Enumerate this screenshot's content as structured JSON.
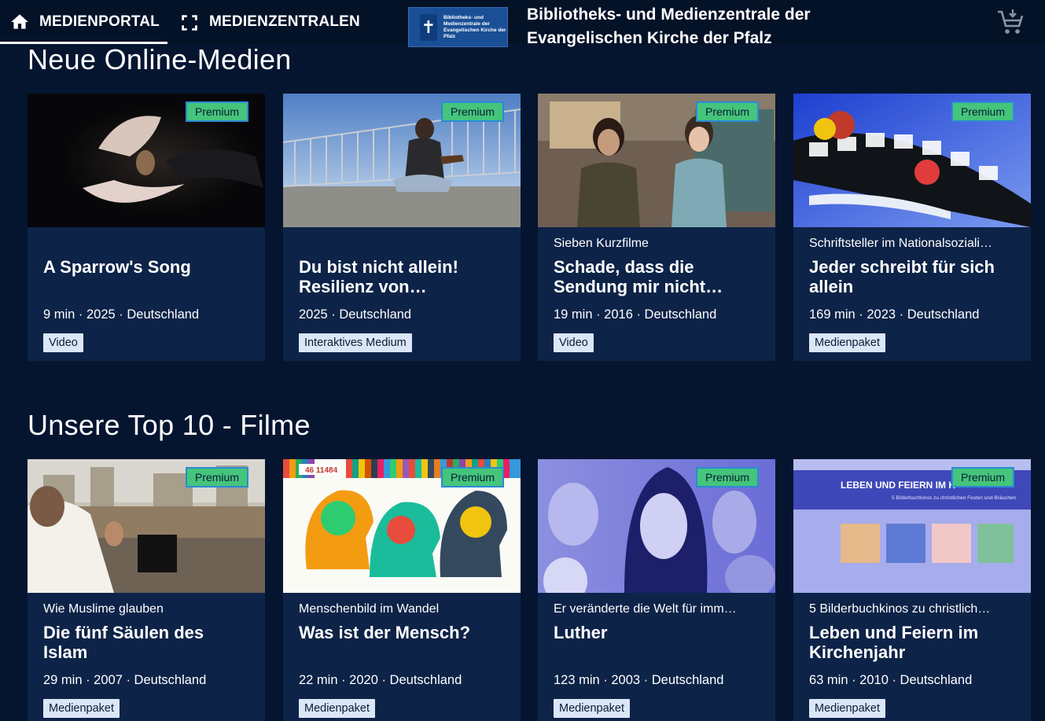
{
  "nav": {
    "portal_label": "MEDIENPORTAL",
    "zentralen_label": "MEDIENZENTRALEN"
  },
  "org": {
    "logo_text": "Bibliotheks- und Medienzentrale der Evangelischen Kirche der Pfalz",
    "title_line1": "Bibliotheks- und Medienzentrale der",
    "title_line2": "Evangelischen Kirche der Pfalz"
  },
  "icons": {
    "home": "home-icon",
    "fullscreen": "fullscreen-icon",
    "cart": "cart-icon"
  },
  "colors": {
    "background": "#051530",
    "card": "#0d2348",
    "premium": "#45c47b",
    "type_tag": "#dbe6f7"
  },
  "sections": [
    {
      "title": "Neue Online-Medien",
      "cards": [
        {
          "badge": "Premium",
          "series": "",
          "title": "A Sparrow's Song",
          "meta": "9 min · 2025 · Deutschland",
          "type": "Video"
        },
        {
          "badge": "Premium",
          "series": "",
          "title": "Du bist nicht allein! Resilienz von…",
          "meta": "2025 · Deutschland",
          "type": "Interaktives Medium"
        },
        {
          "badge": "Premium",
          "series": "Sieben Kurzfilme",
          "title": "Schade, dass die Sendung mir nicht…",
          "meta": "19 min · 2016 · Deutschland",
          "type": "Video"
        },
        {
          "badge": "Premium",
          "series": "Schriftsteller im Nationalsoziali…",
          "title": "Jeder schreibt für sich allein",
          "meta": "169 min · 2023 · Deutschland",
          "type": "Medienpaket"
        }
      ]
    },
    {
      "title": "Unsere Top 10 - Filme",
      "cards": [
        {
          "badge": "Premium",
          "series": "Wie Muslime glauben",
          "title": "Die fünf Säulen des Islam",
          "meta": "29 min · 2007 · Deutschland",
          "type": "Medienpaket"
        },
        {
          "badge": "Premium",
          "series": "Menschenbild im Wandel",
          "title": "Was ist der Mensch?",
          "meta": "22 min · 2020 · Deutschland",
          "type": "Medienpaket"
        },
        {
          "badge": "Premium",
          "series": "Er veränderte die Welt für imm…",
          "title": "Luther",
          "meta": "123 min · 2003 · Deutschland",
          "type": "Medienpaket"
        },
        {
          "badge": "Premium",
          "series": "5 Bilderbuchkinos zu christlich…",
          "title": "Leben und Feiern im Kirchenjahr",
          "meta": "63 min · 2010 · Deutschland",
          "type": "Medienpaket"
        }
      ]
    }
  ],
  "thumb_text": {
    "card6_label": "46 11484",
    "card8_banner": "LEBEN UND FEIERN IM K",
    "card8_sub": "5 Bilderbuchkinos zu christlichen Festen und Bräuchen"
  }
}
